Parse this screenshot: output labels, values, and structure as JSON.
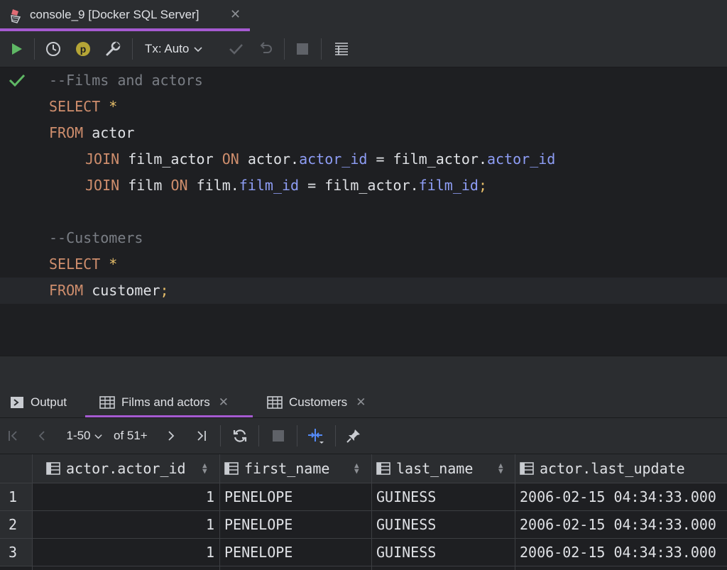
{
  "editor_tab": {
    "title": "console_9 [Docker SQL Server]"
  },
  "toolbar": {
    "tx_mode": "Tx: Auto"
  },
  "editor": {
    "comment1": "--Films and actors",
    "l2_kw": "SELECT",
    "l2_star": "*",
    "l3_kw": "FROM",
    "l3_table": "actor",
    "l4_kw": "JOIN",
    "l4_table": "film_actor",
    "l4_on": "ON",
    "l4_a": "actor.",
    "l4_af": "actor_id",
    "l4_eq": " = ",
    "l4_b": "film_actor.",
    "l4_bf": "actor_id",
    "l5_kw": "JOIN",
    "l5_table": "film",
    "l5_on": "ON",
    "l5_a": "film.",
    "l5_af": "film_id",
    "l5_eq": " = ",
    "l5_b": "film_actor.",
    "l5_bf": "film_id",
    "l5_semi": ";",
    "comment2": "--Customers",
    "l8_kw": "SELECT",
    "l8_star": "*",
    "l9_kw": "FROM",
    "l9_table": "customer",
    "l9_semi": ";"
  },
  "result_tabs": [
    {
      "label": "Output"
    },
    {
      "label": "Films and actors",
      "active": true
    },
    {
      "label": "Customers"
    }
  ],
  "pager": {
    "range": "1-50",
    "total": "of 51+"
  },
  "grid": {
    "columns": [
      "actor.actor_id",
      "first_name",
      "last_name",
      "actor.last_update"
    ],
    "rows": [
      {
        "num": "1",
        "actor_id": "1",
        "first_name": "PENELOPE",
        "last_name": "GUINESS",
        "last_update": "2006-02-15 04:34:33.000"
      },
      {
        "num": "2",
        "actor_id": "1",
        "first_name": "PENELOPE",
        "last_name": "GUINESS",
        "last_update": "2006-02-15 04:34:33.000"
      },
      {
        "num": "3",
        "actor_id": "1",
        "first_name": "PENELOPE",
        "last_name": "GUINESS",
        "last_update": "2006-02-15 04:34:33.000"
      }
    ]
  },
  "colors": {
    "accent": "#a55ad1",
    "keyword": "#cf8e6d",
    "field": "#8e9df5",
    "run": "#5fb865"
  }
}
